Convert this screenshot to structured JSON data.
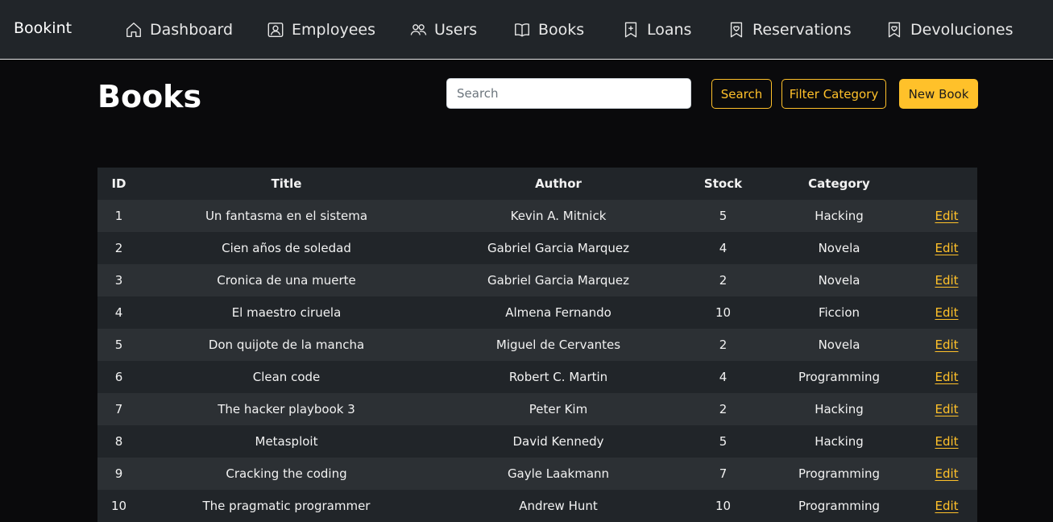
{
  "navbar": {
    "brand": "Bookint",
    "items": [
      {
        "label": "Dashboard",
        "icon": "home-icon"
      },
      {
        "label": "Employees",
        "icon": "person-badge-icon"
      },
      {
        "label": "Users",
        "icon": "people-icon"
      },
      {
        "label": "Books",
        "icon": "book-icon"
      },
      {
        "label": "Loans",
        "icon": "bookmark-plus-icon"
      },
      {
        "label": "Reservations",
        "icon": "bookmark-heart-icon"
      },
      {
        "label": "Devoluciones",
        "icon": "bookmark-heart-icon"
      }
    ]
  },
  "page": {
    "title": "Books"
  },
  "toolbar": {
    "search_placeholder": "Search",
    "search_value": "",
    "search_button": "Search",
    "filter_button": "Filter Category",
    "new_button": "New Book"
  },
  "table": {
    "headers": [
      "ID",
      "Title",
      "Author",
      "Stock",
      "Category",
      ""
    ],
    "edit_label": "Edit",
    "rows": [
      {
        "id": "1",
        "title": "Un fantasma en el sistema",
        "author": "Kevin A. Mitnick",
        "stock": "5",
        "category": "Hacking"
      },
      {
        "id": "2",
        "title": "Cien años de soledad",
        "author": "Gabriel Garcia Marquez",
        "stock": "4",
        "category": "Novela"
      },
      {
        "id": "3",
        "title": "Cronica de una muerte",
        "author": "Gabriel Garcia Marquez",
        "stock": "2",
        "category": "Novela"
      },
      {
        "id": "4",
        "title": "El maestro ciruela",
        "author": "Almena Fernando",
        "stock": "10",
        "category": "Ficcion"
      },
      {
        "id": "5",
        "title": "Don quijote de la mancha",
        "author": "Miguel de Cervantes",
        "stock": "2",
        "category": "Novela"
      },
      {
        "id": "6",
        "title": "Clean code",
        "author": "Robert C. Martin",
        "stock": "4",
        "category": "Programming"
      },
      {
        "id": "7",
        "title": "The hacker playbook 3",
        "author": "Peter Kim",
        "stock": "2",
        "category": "Hacking"
      },
      {
        "id": "8",
        "title": "Metasploit",
        "author": "David Kennedy",
        "stock": "5",
        "category": "Hacking"
      },
      {
        "id": "9",
        "title": "Cracking the coding",
        "author": "Gayle Laakmann",
        "stock": "7",
        "category": "Programming"
      },
      {
        "id": "10",
        "title": "The pragmatic programmer",
        "author": "Andrew Hunt",
        "stock": "10",
        "category": "Programming"
      }
    ]
  },
  "colors": {
    "accent": "#ffc12a",
    "navbar_bg": "#212529",
    "page_bg": "#0a0a0c",
    "row_odd": "#2c3034",
    "row_even": "#212529"
  }
}
